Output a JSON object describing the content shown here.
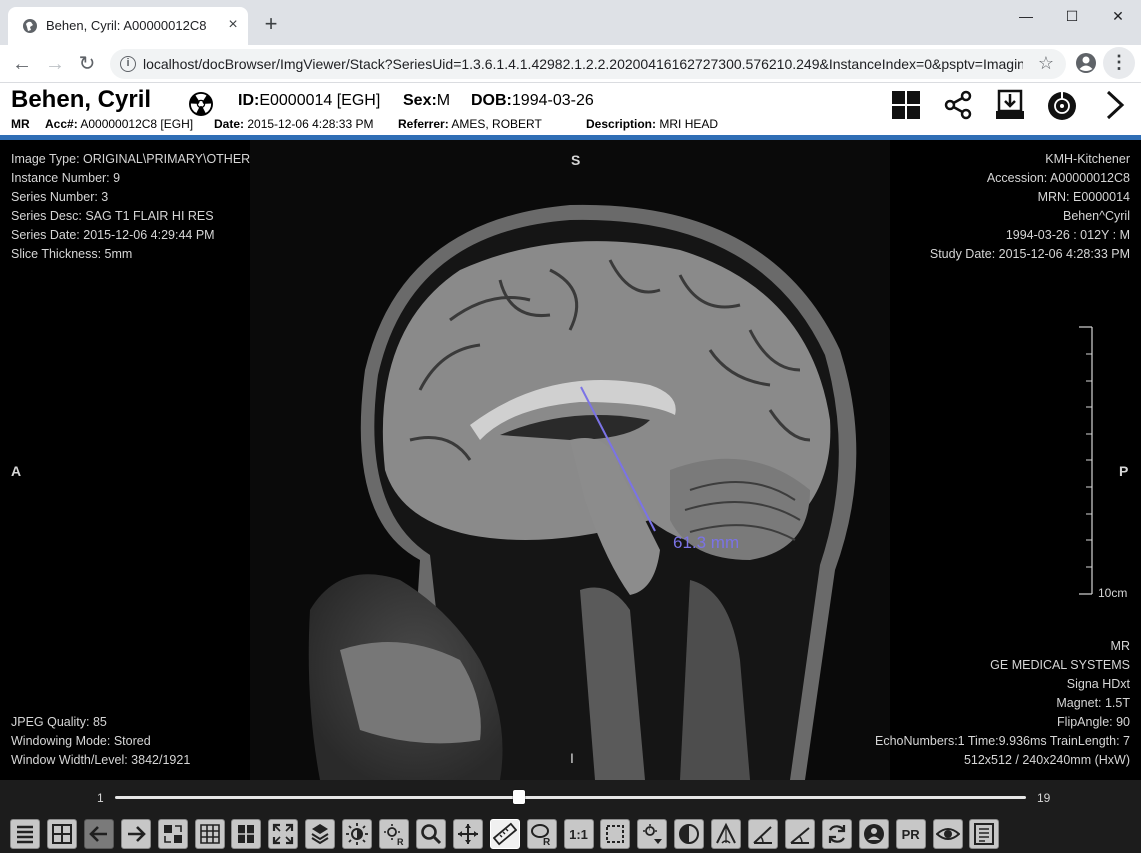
{
  "browser": {
    "tab_title": "Behen, Cyril: A00000012C8",
    "tab_close": "×",
    "new_tab": "+",
    "url": "localhost/docBrowser/ImgViewer/Stack?SeriesUid=1.3.6.1.4.1.42982.1.2.2.20200416162727300.576210.249&InstanceIndex=0&psptv=Imagin...",
    "window_buttons": {
      "minimize": "—",
      "maximize": "☐",
      "close": "✕"
    },
    "nav": {
      "back": "←",
      "forward": "→",
      "reload": "↻"
    },
    "star": "☆",
    "menu": "⋮"
  },
  "header": {
    "patient_name": "Behen, Cyril",
    "id_label": "ID:",
    "id_value": "E0000014 [EGH]",
    "sex_label": "Sex:",
    "sex_value": "M",
    "dob_label": "DOB:",
    "dob_value": "1994-03-26",
    "modality": "MR",
    "acc_label": "Acc#:",
    "acc_value": "A00000012C8 [EGH]",
    "date_label": "Date:",
    "date_value": "2015-12-06 4:28:33 PM",
    "referrer_label": "Referrer:",
    "referrer_value": "AMES, ROBERT",
    "description_label": "Description:",
    "description_value": "MRI HEAD",
    "icons": [
      "layout-grid-icon",
      "share-icon",
      "download-icon",
      "disc-burn-icon",
      "chevron-right-icon"
    ]
  },
  "overlay": {
    "top_left": [
      "Image Type: ORIGINAL\\PRIMARY\\OTHER",
      "Instance Number: 9",
      "Series Number: 3",
      "Series Desc: SAG T1 FLAIR HI RES",
      "Series Date: 2015-12-06 4:29:44 PM",
      "Slice Thickness: 5mm"
    ],
    "top_right": [
      "KMH-Kitchener",
      "Accession: A00000012C8",
      "MRN: E0000014",
      "Behen^Cyril",
      "1994-03-26 : 012Y : M",
      "Study Date: 2015-12-06 4:28:33 PM"
    ],
    "bottom_left": [
      "JPEG Quality: 85",
      "Windowing Mode: Stored",
      "Window Width/Level: 3842/1921"
    ],
    "bottom_right": [
      "MR",
      "GE MEDICAL SYSTEMS",
      "Signa HDxt",
      "Magnet: 1.5T",
      "FlipAngle: 90",
      "EchoNumbers:1 Time:9.936ms TrainLength: 7",
      "512x512 / 240x240mm (HxW)"
    ],
    "orientation": {
      "top": "S",
      "left": "A",
      "right": "P",
      "bottom": "I"
    },
    "measurement": "61.3 mm",
    "scale_label": "10cm",
    "measure_color": "#7b73e6"
  },
  "slider": {
    "min": "1",
    "max": "19",
    "position_fraction": 0.444
  },
  "toolbar": {
    "buttons": [
      {
        "name": "series-list-icon",
        "label": "",
        "state": "normal"
      },
      {
        "name": "layout-icon",
        "label": "",
        "state": "normal"
      },
      {
        "name": "previous-icon",
        "label": "",
        "state": "disabled"
      },
      {
        "name": "next-icon",
        "label": "",
        "state": "normal"
      },
      {
        "name": "swap-icon",
        "label": "",
        "state": "normal"
      },
      {
        "name": "grid-icon",
        "label": "",
        "state": "normal"
      },
      {
        "name": "split-icon",
        "label": "",
        "state": "normal"
      },
      {
        "name": "fit-icon",
        "label": "",
        "state": "normal"
      },
      {
        "name": "stack-icon",
        "label": "",
        "state": "normal"
      },
      {
        "name": "window-level-icon",
        "label": "",
        "state": "normal"
      },
      {
        "name": "roi-window-icon",
        "label": "",
        "state": "normal"
      },
      {
        "name": "zoom-icon",
        "label": "",
        "state": "normal"
      },
      {
        "name": "pan-icon",
        "label": "",
        "state": "normal"
      },
      {
        "name": "ruler-icon",
        "label": "",
        "state": "active"
      },
      {
        "name": "roi-icon",
        "label": "",
        "state": "normal"
      },
      {
        "name": "actual-size-icon",
        "label": "1:1",
        "state": "normal"
      },
      {
        "name": "crop-icon",
        "label": "",
        "state": "normal"
      },
      {
        "name": "window-preset-icon",
        "label": "",
        "state": "normal"
      },
      {
        "name": "invert-icon",
        "label": "",
        "state": "normal"
      },
      {
        "name": "angle-icon",
        "label": "",
        "state": "normal"
      },
      {
        "name": "cobb-angle-icon",
        "label": "",
        "state": "normal"
      },
      {
        "name": "annotate-angle-icon",
        "label": "",
        "state": "normal"
      },
      {
        "name": "rotate-icon",
        "label": "",
        "state": "normal"
      },
      {
        "name": "patient-icon",
        "label": "",
        "state": "normal"
      },
      {
        "name": "presentation-state-icon",
        "label": "PR",
        "state": "normal"
      },
      {
        "name": "eye-icon",
        "label": "",
        "state": "normal"
      },
      {
        "name": "report-icon",
        "label": "",
        "state": "normal"
      }
    ]
  }
}
